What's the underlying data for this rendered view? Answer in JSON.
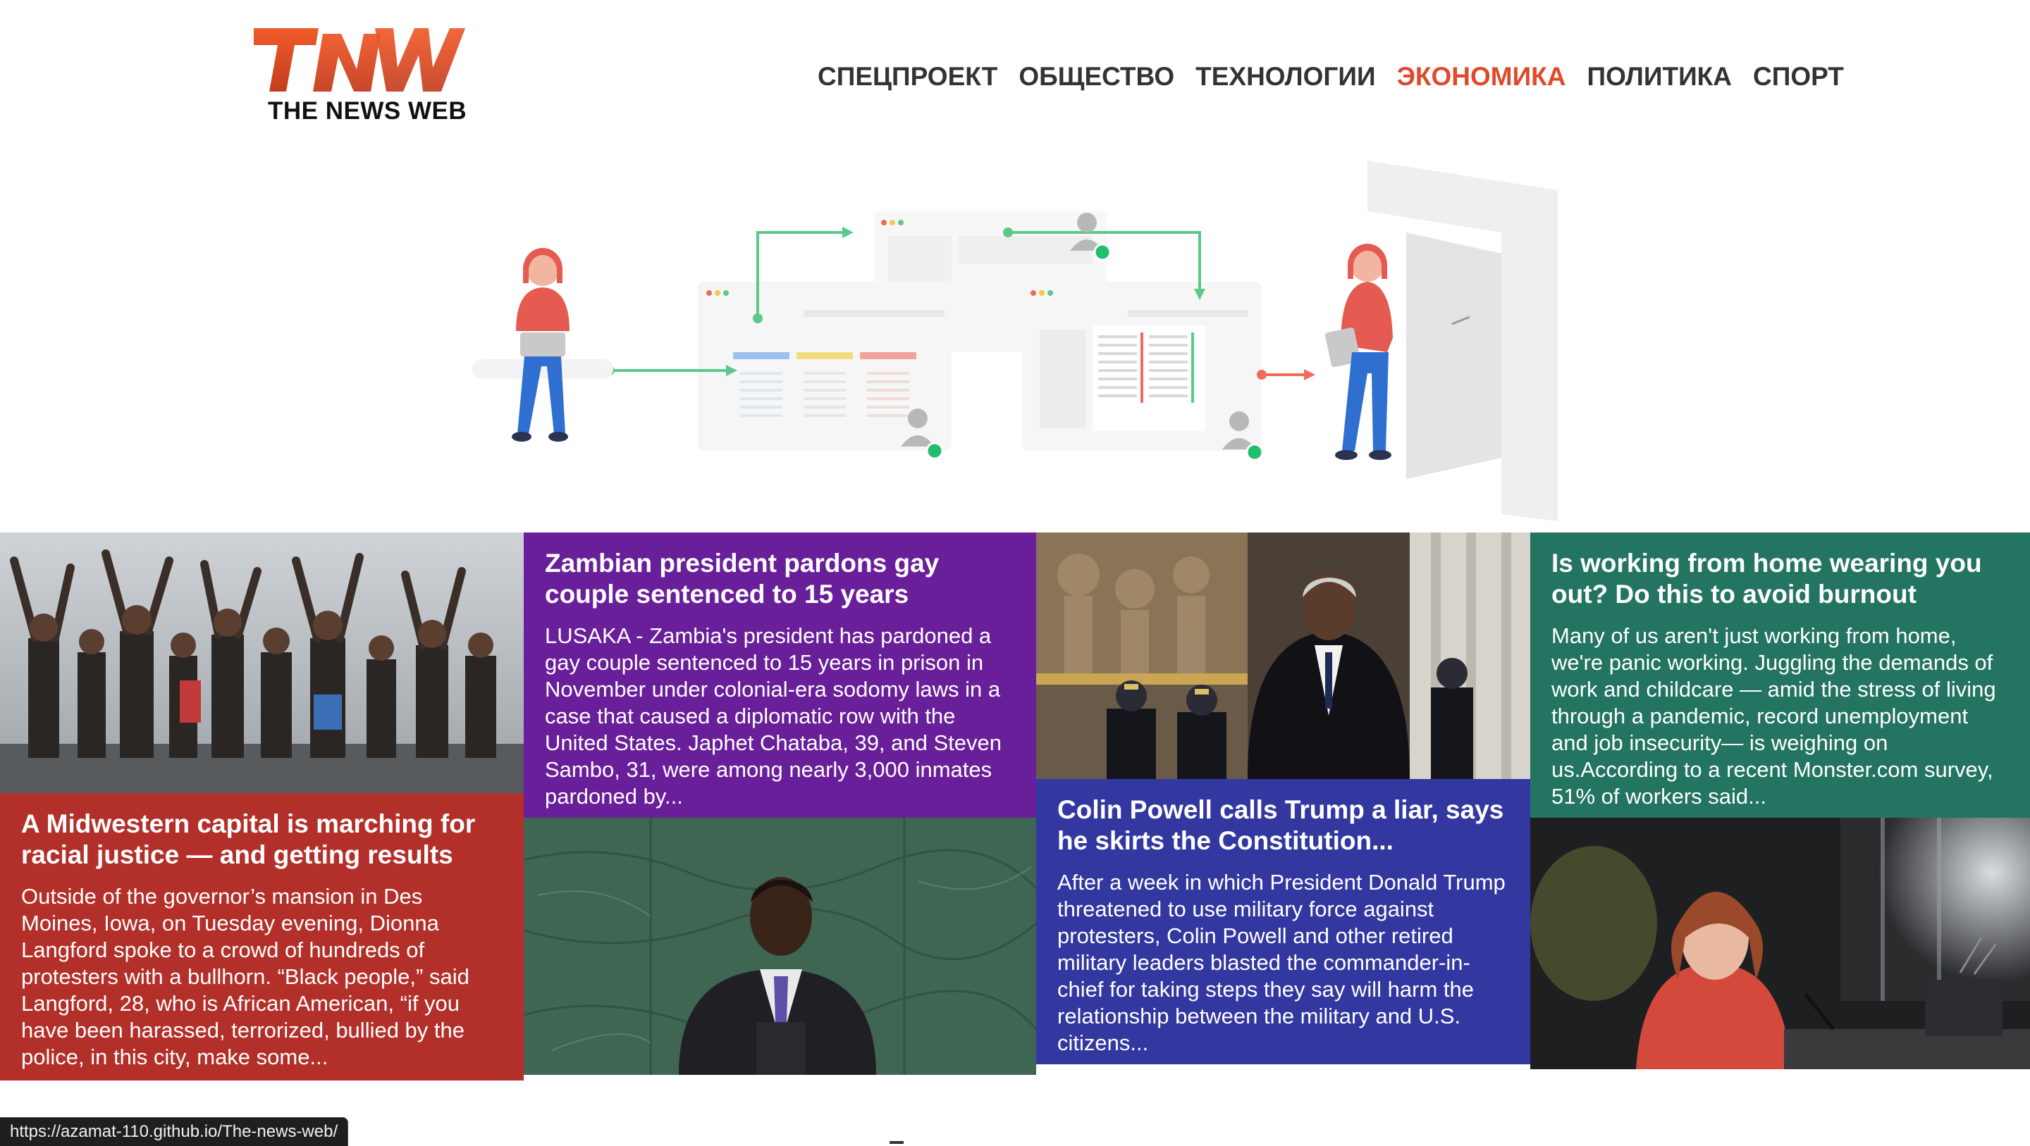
{
  "brand": {
    "logo_text": "TNW",
    "tagline": "THE NEWS WEB",
    "color": "#e04a2c"
  },
  "nav": {
    "items": [
      {
        "label": "СПЕЦПРОЕКТ",
        "active": false
      },
      {
        "label": "ОБЩЕСТВО",
        "active": false
      },
      {
        "label": "ТЕХНОЛОГИИ",
        "active": false
      },
      {
        "label": "ЭКОНОМИКА",
        "active": true
      },
      {
        "label": "ПОЛИТИКА",
        "active": false
      },
      {
        "label": "СПОРТ",
        "active": false
      }
    ],
    "active_color": "#e04a2c"
  },
  "articles": [
    {
      "headline": "A Midwestern capital is marching for racial justice — and getting results",
      "excerpt": "Outside of the governor’s mansion in Des Moines, Iowa, on Tuesday evening, Dionna Langford spoke to a crowd of hundreds of protesters with a bullhorn. “Black people,” said Langford, 28, who is African American, “if you have been harassed, terrorized, bullied by the police, in this city, make some...",
      "color": "#b3302a",
      "image": "protest-photo"
    },
    {
      "headline": "Zambian president pardons gay couple sentenced to 15 years",
      "excerpt": "LUSAKA - Zambia's president has pardoned a gay couple sentenced to 15 years in prison in November under colonial-era sodomy laws in a case that caused a diplomatic row with the United States. Japhet Chataba, 39, and Steven Sambo, 31, were among nearly 3,000 inmates pardoned by...",
      "color": "#6a1f9a",
      "image": "president-speech-photo"
    },
    {
      "headline": "Colin Powell calls Trump a liar, says he skirts the Constitution...",
      "excerpt": "After a week in which President Donald Trump threatened to use military force against protesters, Colin Powell and other retired military leaders blasted the commander-in-chief for taking steps they say will harm the relationship between the military and U.S. citizens...",
      "color": "#3338a0",
      "image": "capitol-photo"
    },
    {
      "headline": "Is working from home wearing you out? Do this to avoid burnout",
      "excerpt": "Many of us aren't just working from home, we're panic working. Juggling the demands of work and childcare — amid the stress of living through a pandemic, record unemployment and job insecurity— is weighing on us.According to a recent Monster.com survey, 51% of workers said...",
      "color": "#237460",
      "image": "home-office-photo"
    }
  ],
  "status_bar": {
    "url": "https://azamat-110.github.io/The-news-web/"
  }
}
